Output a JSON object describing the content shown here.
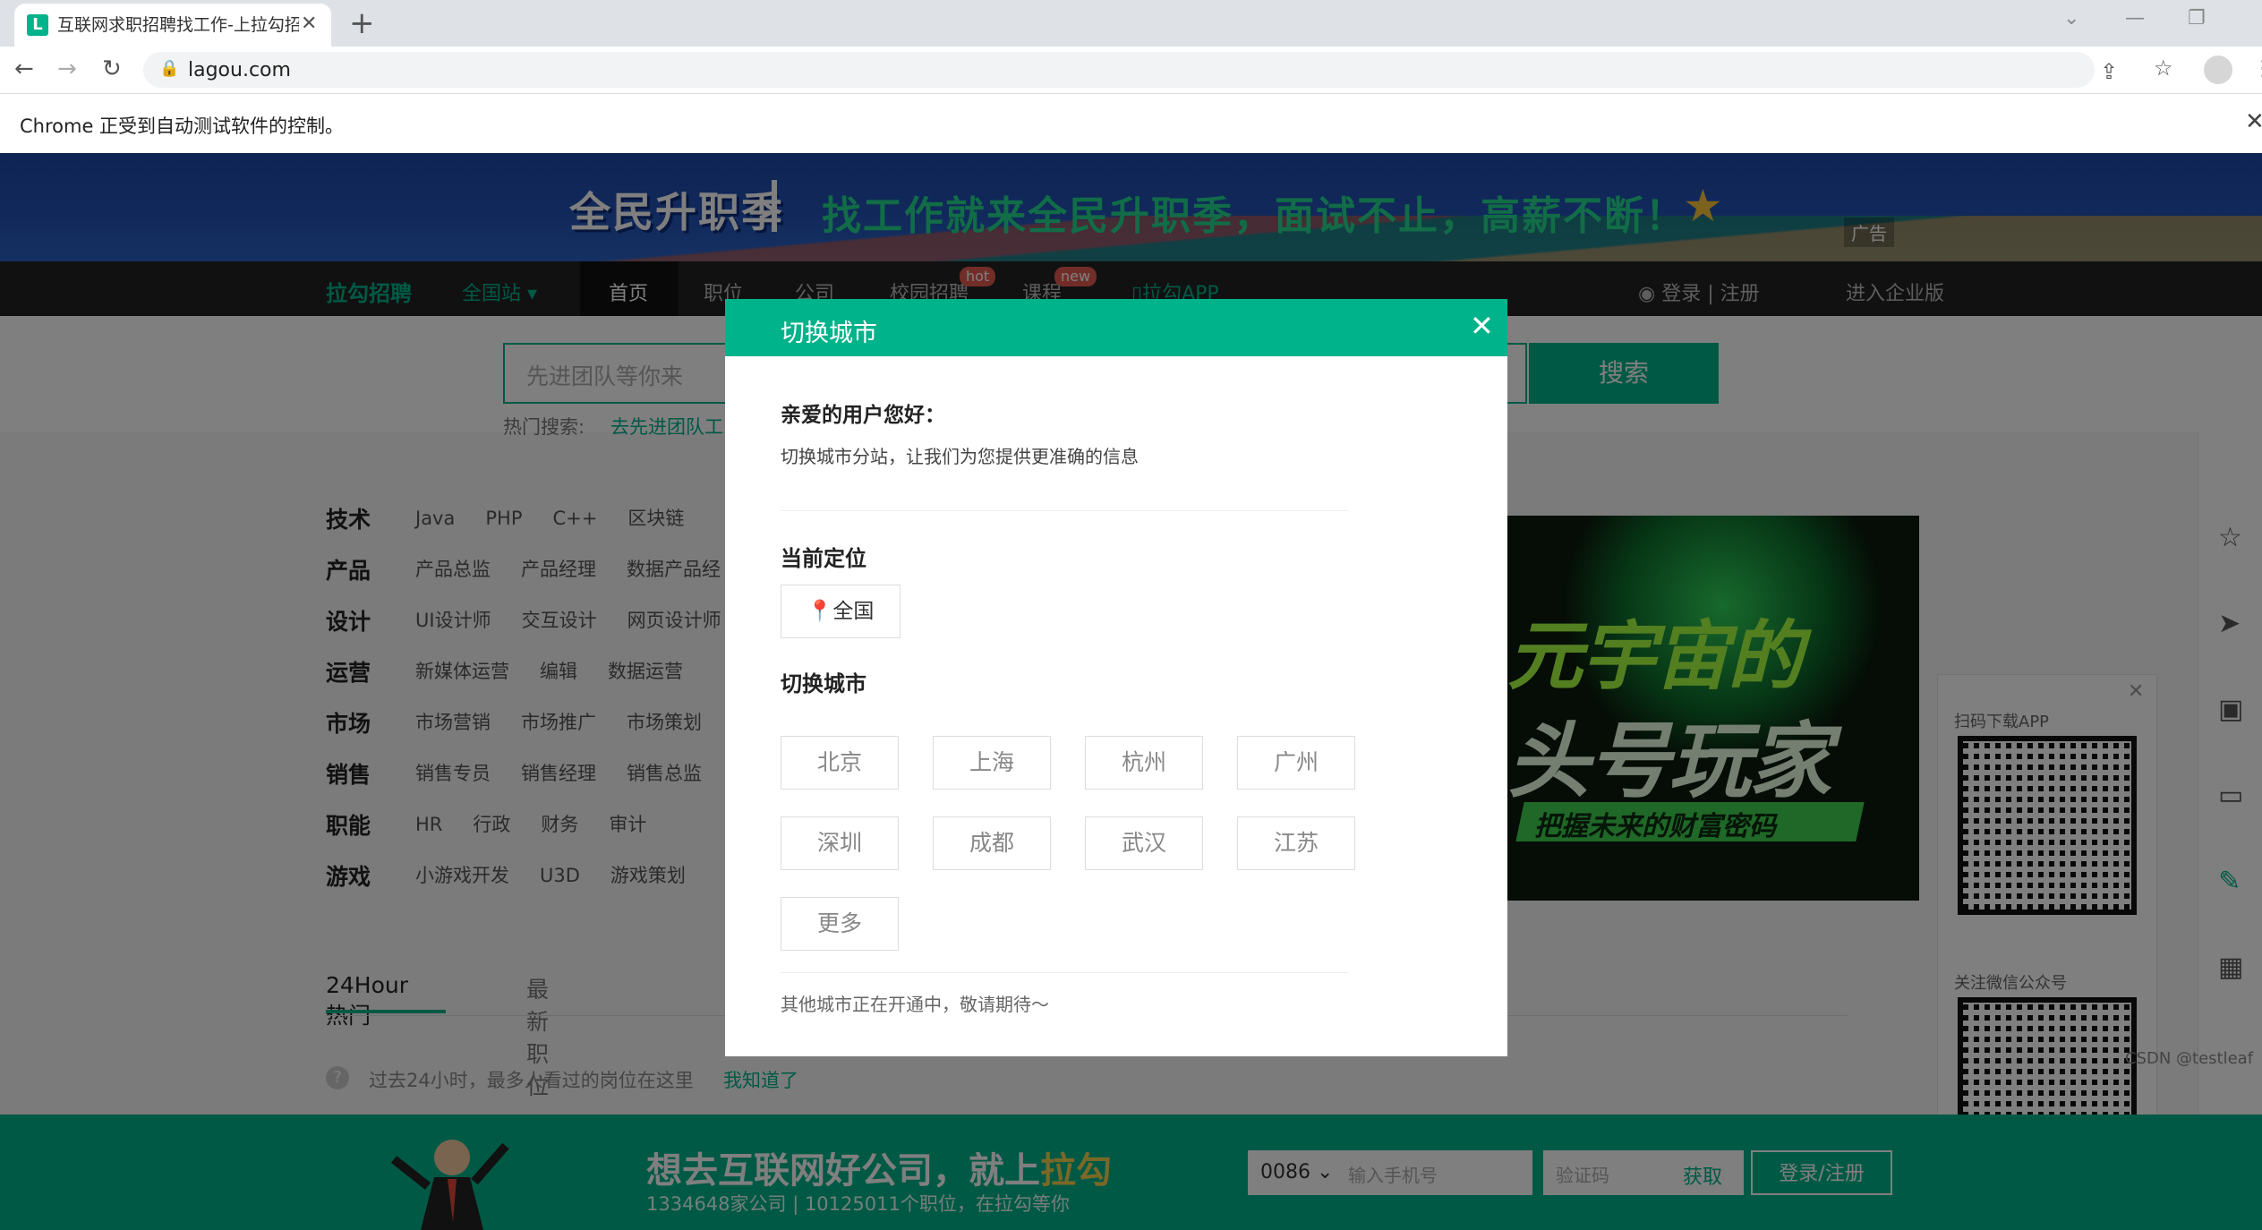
{
  "browser": {
    "tab_title": "互联网求职招聘找工作-上拉勾招",
    "tab_favicon": "L",
    "url": "lagou.com",
    "automation_notice": "Chrome 正受到自动测试软件的控制。"
  },
  "banner": {
    "logo_text": "全民升职季",
    "slogan": "找工作就来全民升职季，面试不止，高薪不断！",
    "ad_label": "广告"
  },
  "topnav": {
    "logo": "拉勾招聘",
    "city": "全国站",
    "items": [
      "首页",
      "职位",
      "公司",
      "校园招聘",
      "课程",
      "拉勾APP"
    ],
    "badge_hot": "hot",
    "badge_new": "new",
    "login": "登录",
    "register": "注册",
    "enterprise": "进入企业版"
  },
  "search": {
    "placeholder": "先进团队等你来",
    "button": "搜索",
    "hot_label": "热门搜索:",
    "hot_item": "去先进团队工"
  },
  "categories": [
    {
      "name": "技术",
      "items": [
        "Java",
        "PHP",
        "C++",
        "区块链"
      ]
    },
    {
      "name": "产品",
      "items": [
        "产品总监",
        "产品经理",
        "数据产品经"
      ]
    },
    {
      "name": "设计",
      "items": [
        "UI设计师",
        "交互设计",
        "网页设计师"
      ]
    },
    {
      "name": "运营",
      "items": [
        "新媒体运营",
        "编辑",
        "数据运营"
      ]
    },
    {
      "name": "市场",
      "items": [
        "市场营销",
        "市场推广",
        "市场策划"
      ]
    },
    {
      "name": "销售",
      "items": [
        "销售专员",
        "销售经理",
        "销售总监"
      ]
    },
    {
      "name": "职能",
      "items": [
        "HR",
        "行政",
        "财务",
        "审计"
      ]
    },
    {
      "name": "游戏",
      "items": [
        "小游戏开发",
        "U3D",
        "游戏策划"
      ]
    }
  ],
  "tabs24": {
    "hot": "24Hour热门",
    "new": "最新职位",
    "tip": "过去24小时，最多人看过的岗位在这里",
    "tip_link": "我知道了"
  },
  "promo": {
    "line1": "元宇宙的",
    "line2": "头号玩家",
    "line3": "把握未来的财富密码"
  },
  "qr": {
    "download_label": "扫码下载APP",
    "wechat_label": "关注微信公众号"
  },
  "sidebar_icons": [
    "star-icon",
    "send-icon",
    "resume-icon",
    "inbox-icon",
    "edit-icon",
    "qrcode-icon"
  ],
  "footer": {
    "title_prefix": "想去互联网好公司，就上",
    "title_highlight": "拉勾",
    "subtitle": "1334648家公司 | 10125011个职位，在拉勾等你",
    "phone_code": "0086",
    "phone_placeholder": "输入手机号",
    "code_placeholder": "验证码",
    "get_code": "获取",
    "register_button": "登录/注册"
  },
  "modal": {
    "title": "切换城市",
    "greeting": "亲爱的用户您好：",
    "description": "切换城市分站，让我们为您提供更准确的信息",
    "current_label": "当前定位",
    "current_city": "全国",
    "switch_label": "切换城市",
    "cities": [
      "北京",
      "上海",
      "杭州",
      "广州",
      "深圳",
      "成都",
      "武汉",
      "江苏",
      "更多"
    ],
    "footer_note": "其他城市正在开通中，敬请期待～"
  },
  "watermark": "CSDN @testleaf",
  "colors": {
    "brand": "#00b38a",
    "overlay": "rgba(0,0,0,0.5)"
  }
}
